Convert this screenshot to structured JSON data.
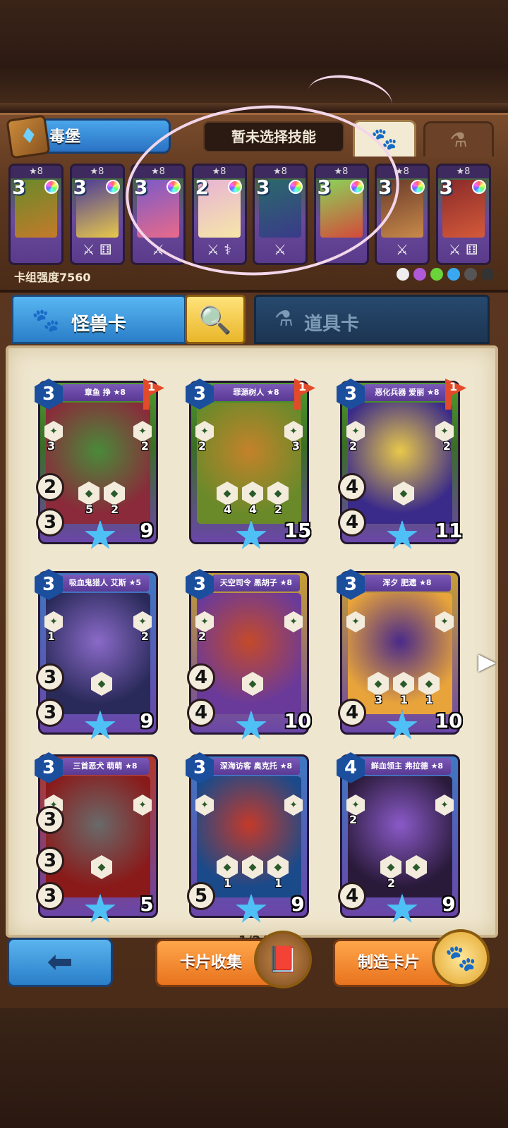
{
  "deck": {
    "name": "毒堡",
    "skill_status": "暂未选择技能",
    "power_label": "卡组强度7560",
    "mini_cards": [
      {
        "stars": "★8",
        "cost": "3",
        "tools": "",
        "colors": [
          "#6a8a2a",
          "#c47a2a"
        ]
      },
      {
        "stars": "★8",
        "cost": "3",
        "tools": "⚔ ⚅",
        "colors": [
          "#4a3a9a",
          "#e8c84a"
        ]
      },
      {
        "stars": "★8",
        "cost": "3",
        "tools": "⚔",
        "colors": [
          "#7a5ac8",
          "#e86a8a"
        ]
      },
      {
        "stars": "★8",
        "cost": "2",
        "tools": "⚔ ⚕",
        "colors": [
          "#e8b4d4",
          "#f6e6a8"
        ]
      },
      {
        "stars": "★8",
        "cost": "3",
        "tools": "⚔",
        "colors": [
          "#2a6a6a",
          "#3a3a8a"
        ]
      },
      {
        "stars": "★8",
        "cost": "3",
        "tools": "",
        "colors": [
          "#8ad45a",
          "#d44a3a"
        ]
      },
      {
        "stars": "★8",
        "cost": "3",
        "tools": "⚔",
        "colors": [
          "#6a3a2a",
          "#c88a4a"
        ]
      },
      {
        "stars": "★8",
        "cost": "3",
        "tools": "⚔ ⚅",
        "colors": [
          "#8a2a2a",
          "#d45a3a"
        ]
      }
    ],
    "element_colors": [
      "#eeeeee",
      "#b05ad8",
      "#6ad43a",
      "#3aa8f0",
      "#555555",
      "#333333"
    ]
  },
  "tabs": {
    "monster_label": "怪兽卡",
    "item_label": "道具卡",
    "monster_icon": "paw-icon",
    "item_icon": "potion-icon",
    "search_icon": "search-icon"
  },
  "cards": [
    {
      "name": "章鱼 挣 ★8",
      "cost": "3",
      "flag": "1",
      "stat1": "2",
      "stat2": "3",
      "hp": "9",
      "hexnums": [
        "5",
        "2"
      ],
      "side_nums": [
        "3",
        "2"
      ],
      "frame": "green",
      "art": [
        "#8a2a3a",
        "#4a8a3a"
      ]
    },
    {
      "name": "罪源树人 ★8",
      "cost": "3",
      "flag": "1",
      "stat1": "",
      "stat2": "",
      "hp": "15",
      "hexnums": [
        "4",
        "4",
        "2"
      ],
      "side_nums": [
        "2",
        "3"
      ],
      "frame": "green",
      "art": [
        "#6a8a2a",
        "#c4822a"
      ]
    },
    {
      "name": "恶化兵器 爱丽 ★8",
      "cost": "3",
      "flag": "1",
      "stat1": "4",
      "stat2": "4",
      "hp": "11",
      "hexnums": [
        ""
      ],
      "side_nums": [
        "2",
        "2"
      ],
      "frame": "green",
      "art": [
        "#3a2a8a",
        "#e8c84a"
      ]
    },
    {
      "name": "吸血鬼猎人 艾斯 ★5",
      "cost": "3",
      "flag": "",
      "stat1": "3",
      "stat2": "3",
      "hp": "9",
      "hexnums": [
        ""
      ],
      "side_nums": [
        "1",
        "2"
      ],
      "frame": "blue",
      "art": [
        "#2a2a5a",
        "#8a6ac8"
      ]
    },
    {
      "name": "天空司令 黑胡子 ★8",
      "cost": "3",
      "flag": "",
      "stat1": "4",
      "stat2": "4",
      "hp": "10",
      "hexnums": [
        ""
      ],
      "side_nums": [
        "2",
        ""
      ],
      "frame": "gold",
      "art": [
        "#6a3a9a",
        "#c44a2a"
      ]
    },
    {
      "name": "浑夕 肥遗 ★8",
      "cost": "3",
      "flag": "",
      "stat1": "",
      "stat2": "4",
      "hp": "10",
      "hexnums": [
        "3",
        "1",
        "1"
      ],
      "side_nums": [
        "",
        ""
      ],
      "frame": "gold",
      "art": [
        "#e8a43a",
        "#4a2a8a"
      ]
    },
    {
      "name": "三首恶犬 萌萌 ★8",
      "cost": "3",
      "flag": "",
      "stat1": "3",
      "stat2": "3",
      "hp": "5",
      "hexnums": [
        ""
      ],
      "side_nums": [
        "",
        ""
      ],
      "frame": "red",
      "art": [
        "#8a1a1a",
        "#6a6a6a"
      ],
      "stat3": "3"
    },
    {
      "name": "深海访客 奥克托 ★8",
      "cost": "3",
      "flag": "",
      "stat1": "",
      "stat2": "5",
      "hp": "9",
      "hexnums": [
        "1",
        "",
        "1"
      ],
      "side_nums": [
        "",
        ""
      ],
      "frame": "blue",
      "art": [
        "#1a4a8a",
        "#c43a2a"
      ]
    },
    {
      "name": "鲜血领主 弗拉德 ★8",
      "cost": "4",
      "flag": "",
      "stat1": "",
      "stat2": "4",
      "hp": "9",
      "hexnums": [
        "2",
        ""
      ],
      "side_nums": [
        "2",
        ""
      ],
      "frame": "blue",
      "art": [
        "#2a1a3a",
        "#8a5ac8"
      ]
    }
  ],
  "pagination": {
    "label": "1/24"
  },
  "buttons": {
    "back_icon": "back-arrow-icon",
    "collection_label": "卡片收集",
    "craft_label": "制造卡片"
  }
}
